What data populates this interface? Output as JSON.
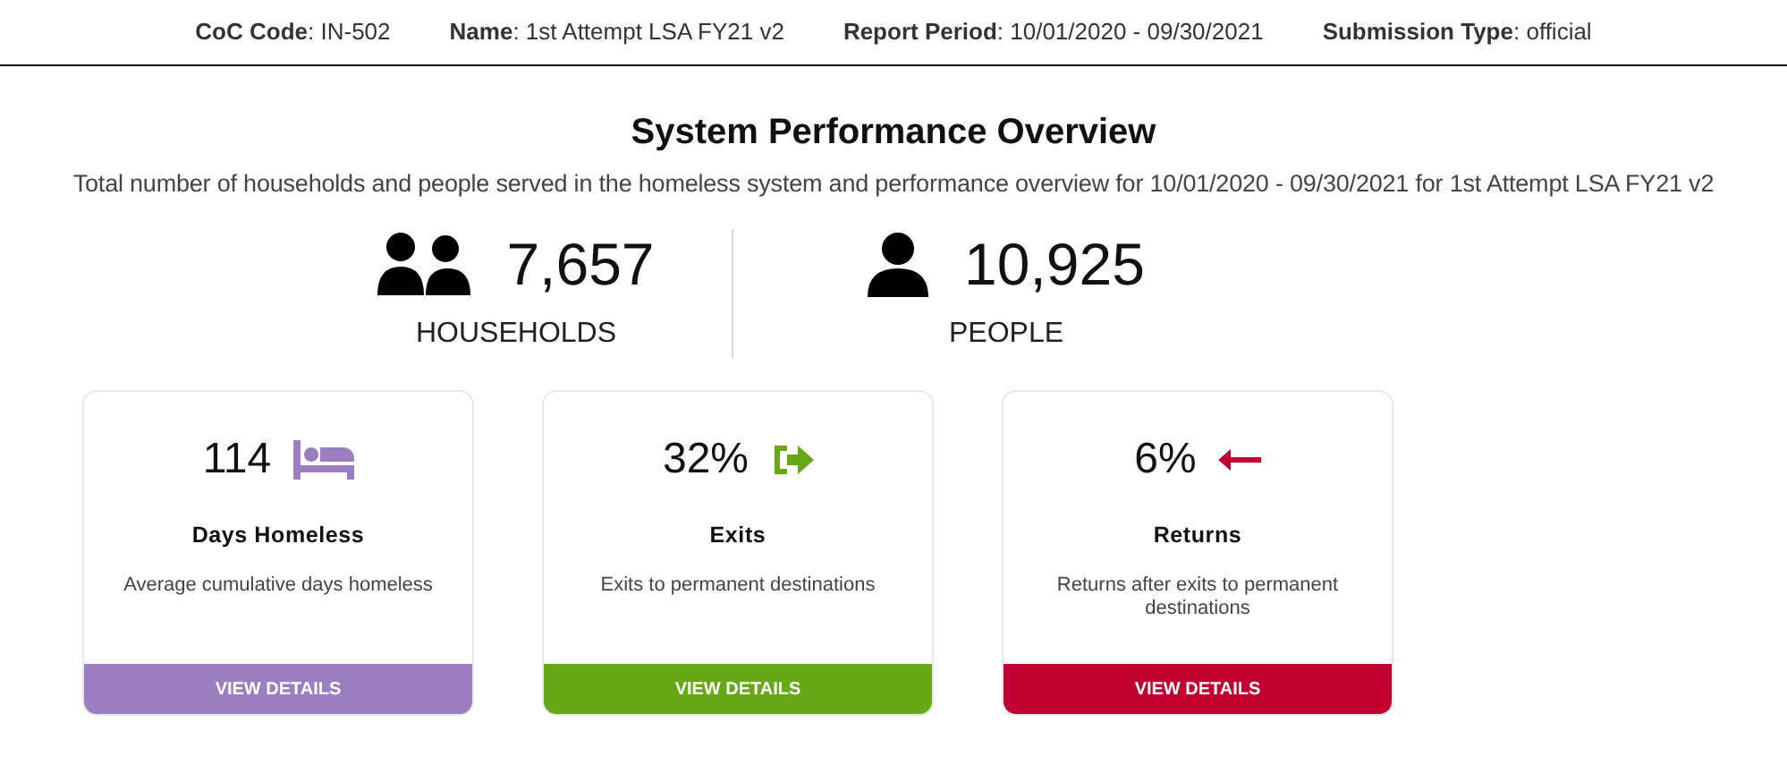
{
  "header": [
    "**CoC Code**: IN-502",
    "**Name**: 1st Attempt LSA FY21 v2",
    "**Report Period**: 10/01/2020 - 09/30/2021",
    "**Submission Type**: official"
  ],
  "title": "System Performance Overview",
  "subtitle": "Total number of households and people served in the homeless system and performance overview for 10/01/2020 - 09/30/2021 for 1st Attempt LSA FY21 v2",
  "stats": [
    {
      "kind": "households",
      "value": "7,657",
      "label": "HOUSEHOLDS"
    },
    {
      "kind": "people",
      "value": "10,925",
      "label": "PEOPLE"
    }
  ],
  "cards": [
    {
      "kind": "bed",
      "value": "114",
      "title": "Days Homeless",
      "description": "Average cumulative days homeless",
      "button": "VIEW DETAILS",
      "color": "#9b7fc1"
    },
    {
      "kind": "exit",
      "value": "32%",
      "title": "Exits",
      "description": "Exits to permanent destinations",
      "button": "VIEW DETAILS",
      "color": "#67a817"
    },
    {
      "kind": "return",
      "value": "6%",
      "title": "Returns",
      "description": "Returns after exits to permanent destinations",
      "button": "VIEW DETAILS",
      "color": "#c00030"
    }
  ]
}
